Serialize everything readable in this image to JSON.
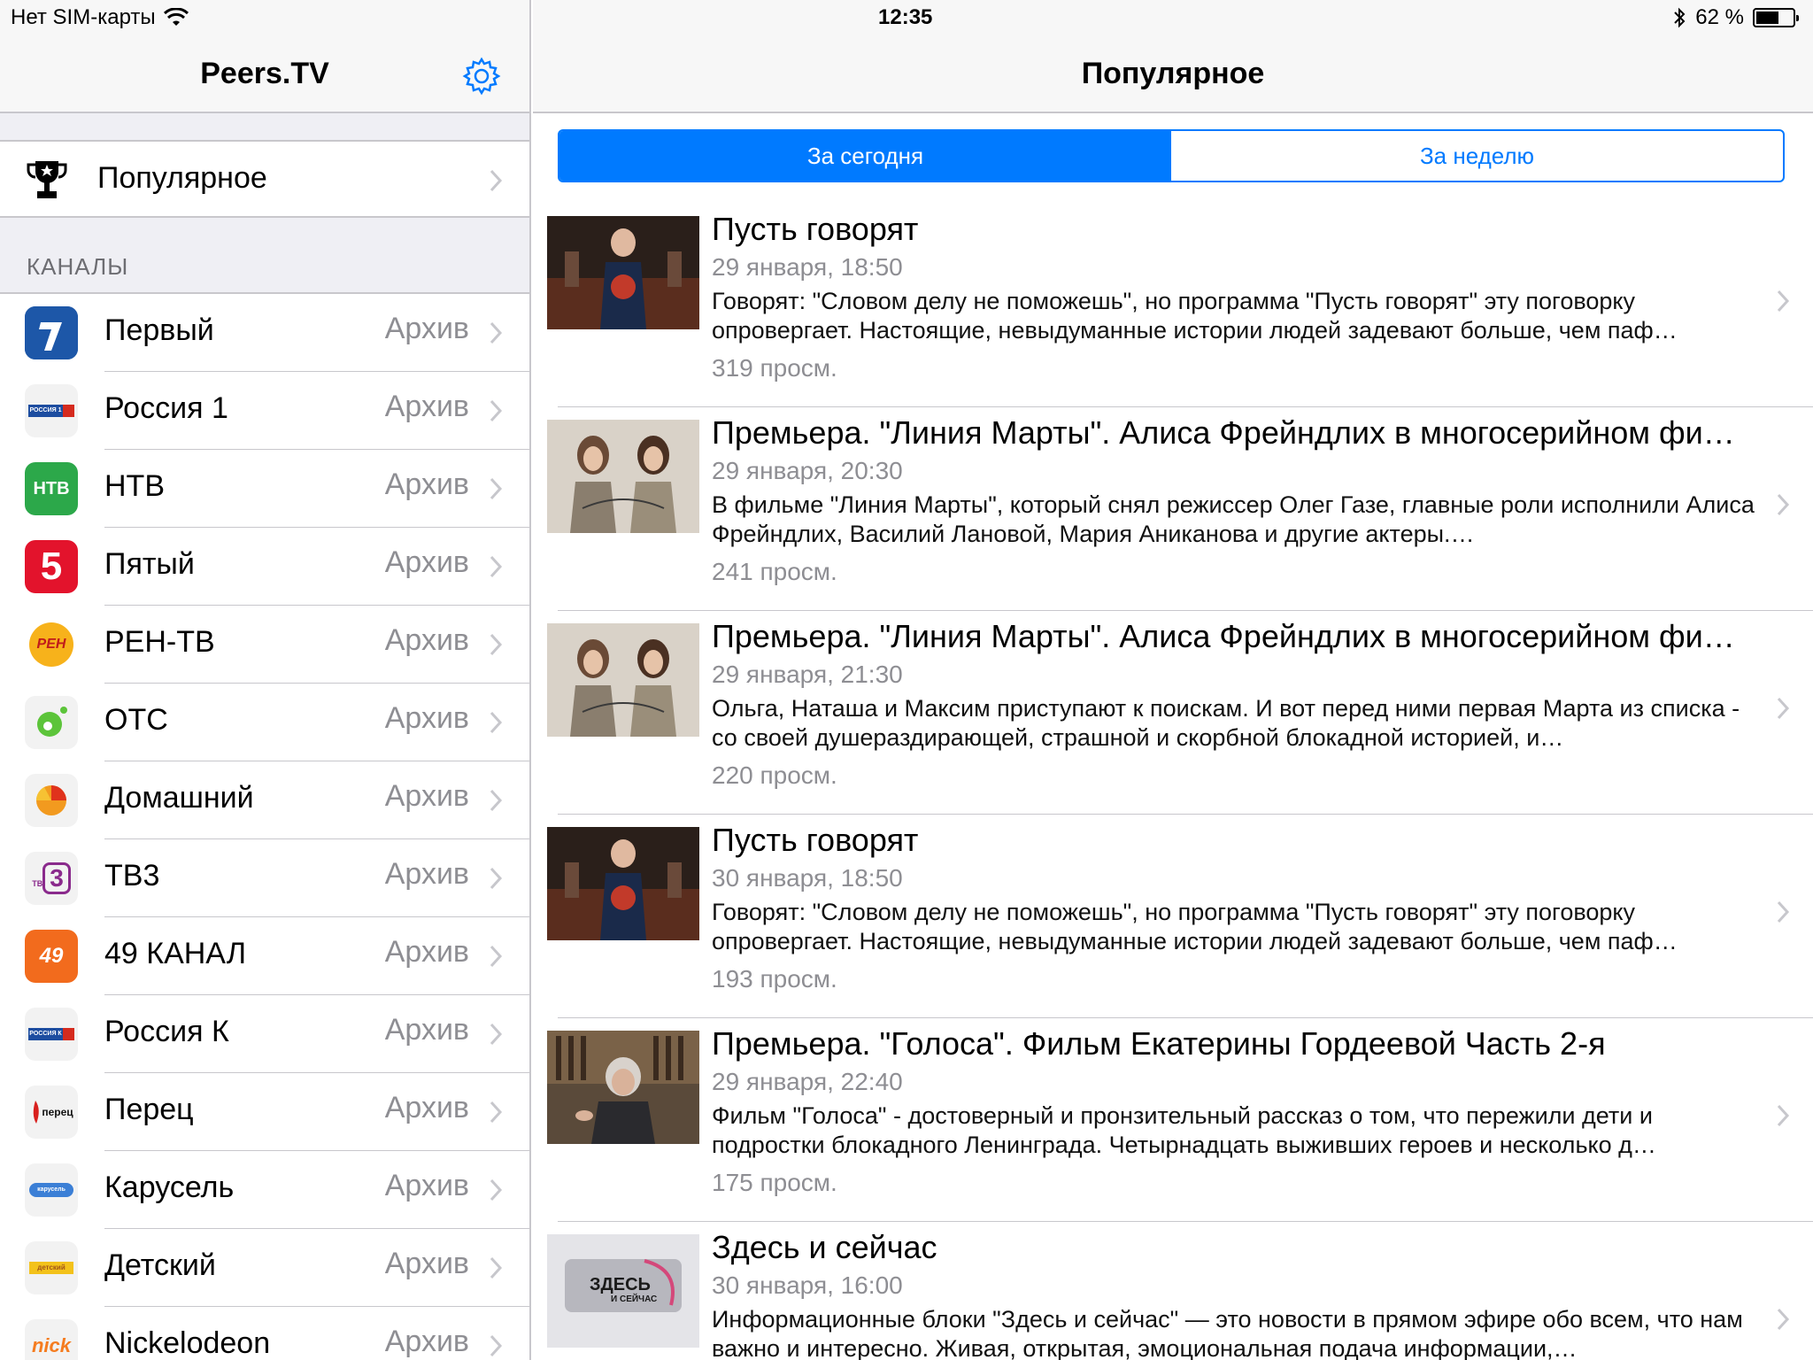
{
  "status": {
    "carrier": "Нет SIM-карты",
    "time": "12:35",
    "battery_text": "62 %",
    "battery_level": 0.62
  },
  "sidebar": {
    "title": "Peers.TV",
    "popular_label": "Популярное",
    "section_header": "КАНАЛЫ",
    "channels": [
      {
        "name": "Первый",
        "archive": "Архив"
      },
      {
        "name": "Россия 1",
        "archive": "Архив"
      },
      {
        "name": "НТВ",
        "archive": "Архив"
      },
      {
        "name": "Пятый",
        "archive": "Архив"
      },
      {
        "name": "РЕН-ТВ",
        "archive": "Архив"
      },
      {
        "name": "ОТС",
        "archive": "Архив"
      },
      {
        "name": "Домашний",
        "archive": "Архив"
      },
      {
        "name": "ТВ3",
        "archive": "Архив"
      },
      {
        "name": "49 КАНАЛ",
        "archive": "Архив"
      },
      {
        "name": "Россия К",
        "archive": "Архив"
      },
      {
        "name": "Перец",
        "archive": "Архив"
      },
      {
        "name": "Карусель",
        "archive": "Архив"
      },
      {
        "name": "Детский",
        "archive": "Архив"
      },
      {
        "name": "Nickelodeon",
        "archive": "Архив"
      }
    ],
    "logos": {
      "rossiya1": "РОССИЯ 1",
      "ntv": "НТВ",
      "pyatyi": "5",
      "ren": "РЕН",
      "tv3_small": "ТВ",
      "tv3_big": "3",
      "ch49": "49",
      "rossiyak": "РОССИЯ К",
      "perets": "перец",
      "karusel": "карусель",
      "detskiy": "детский",
      "nick": "nick"
    }
  },
  "main": {
    "title": "Популярное",
    "tabs": [
      {
        "label": "За сегодня",
        "active": true
      },
      {
        "label": "За неделю",
        "active": false
      }
    ],
    "items": [
      {
        "title": "Пусть говорят",
        "date": "29 января, 18:50",
        "desc": "Говорят: \"Словом делу не поможешь\", но программа \"Пусть говорят\" эту поговорку опровергает. Настоящие, невыдуманные истории людей задевают больше, чем паф…",
        "views": "319 просм."
      },
      {
        "title": "Премьера. \"Линия Марты\". Алиса Фрейндлих в многосерийном фи…",
        "date": "29 января, 20:30",
        "desc": "В фильме \"Линия Марты\", который снял режиссер Олег Газе, главные роли исполнили Алиса Фрейндлих, Василий Лановой, Мария Аниканова и другие актеры.…",
        "views": "241 просм."
      },
      {
        "title": "Премьера. \"Линия Марты\". Алиса Фрейндлих в многосерийном фи…",
        "date": "29 января, 21:30",
        "desc": "Ольга, Наташа и Максим приступают к поискам. И вот перед ними первая Марта из списка - со своей душераздирающей, страшной и скорбной блокадной историей, и…",
        "views": "220 просм."
      },
      {
        "title": "Пусть говорят",
        "date": "30 января, 18:50",
        "desc": "Говорят: \"Словом делу не поможешь\", но программа \"Пусть говорят\" эту поговорку опровергает. Настоящие, невыдуманные истории людей задевают больше, чем паф…",
        "views": "193 просм."
      },
      {
        "title": "Премьера. \"Голоса\". Фильм Екатерины Гордеевой Часть 2-я",
        "date": "29 января, 22:40",
        "desc": "Фильм \"Голоса\" - достоверный и пронзительный рассказ о том, что пережили дети и подростки блокадного Ленинграда. Четырнадцать выживших героев и несколько д…",
        "views": "175 просм."
      },
      {
        "title": "Здесь и сейчас",
        "date": "30 января, 16:00",
        "desc": "Информационные блоки \"Здесь и сейчас\" — это новости в прямом эфире обо всем, что нам важно и интересно. Живая, открытая, эмоциональная подача информации,…",
        "views": "",
        "thumb_text_big": "ЗДЕСЬ",
        "thumb_text_small": "И СЕЙЧАС"
      }
    ]
  },
  "colors": {
    "accent": "#007aff",
    "separator": "#c8c7cc",
    "secondary_text": "#8e8e93",
    "group_bg": "#efeff4"
  }
}
